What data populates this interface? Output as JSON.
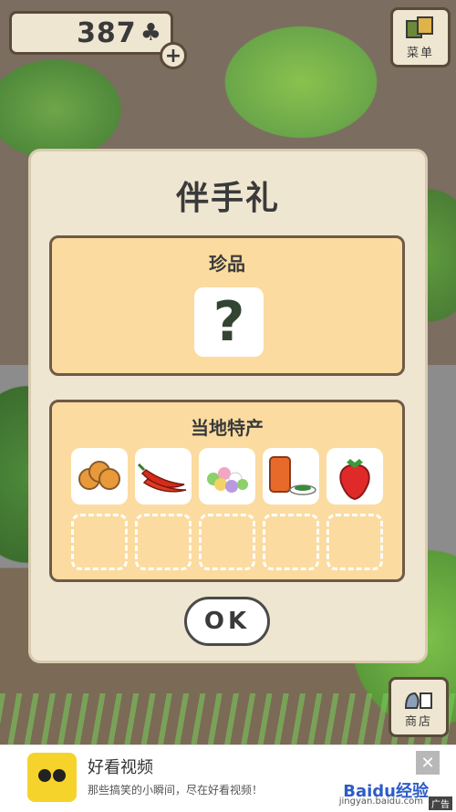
{
  "hud": {
    "clover_count": "387",
    "clover_symbol": "♣",
    "plus_label": "+"
  },
  "menu_button": {
    "label": "菜单"
  },
  "shop_button": {
    "label": "商店"
  },
  "dialog": {
    "title": "伴手礼",
    "treasure": {
      "title": "珍品",
      "unknown_symbol": "?"
    },
    "local_specialties": {
      "title": "当地特产",
      "items": [
        "orange-slices",
        "red-chili-peppers",
        "dango",
        "canned-food-with-salad",
        "strawberry"
      ],
      "empty_slots": 5
    },
    "ok_label": "OK"
  },
  "ad": {
    "title": "好看视频",
    "subtitle": "那些搞笑的小瞬间，尽在好看视频！",
    "brand": "Baidu经验",
    "domain": "jingyan.baidu.com",
    "tag": "广告",
    "close_symbol": "✕"
  },
  "colors": {
    "panel": "#fbdba0",
    "dialog": "#efe6d1",
    "border": "#6e5a48"
  }
}
